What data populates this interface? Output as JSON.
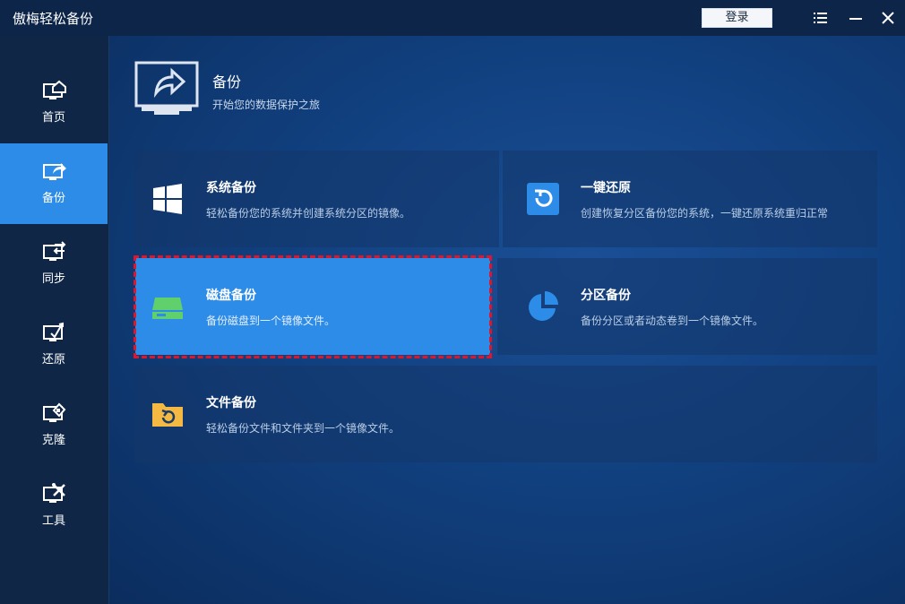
{
  "window": {
    "title": "傲梅轻松备份",
    "login_label": "登录",
    "controls": [
      "menu-icon",
      "minimize-icon",
      "close-icon"
    ]
  },
  "sidebar": {
    "items": [
      {
        "label": "首页",
        "icon": "home-monitor-icon",
        "active": false
      },
      {
        "label": "备份",
        "icon": "backup-monitor-icon",
        "active": true
      },
      {
        "label": "同步",
        "icon": "sync-monitor-icon",
        "active": false
      },
      {
        "label": "还原",
        "icon": "restore-monitor-icon",
        "active": false
      },
      {
        "label": "克隆",
        "icon": "clone-monitor-icon",
        "active": false
      },
      {
        "label": "工具",
        "icon": "tools-monitor-icon",
        "active": false
      }
    ]
  },
  "header": {
    "title": "备份",
    "subtitle": "开始您的数据保护之旅",
    "icon": "backup-monitor-large-icon"
  },
  "cards": [
    {
      "title": "系统备份",
      "desc": "轻松备份您的系统并创建系统分区的镜像。",
      "icon": "windows-icon"
    },
    {
      "title": "一键还原",
      "desc": "创建恢复分区备份您的系统，一键还原系统重归正常",
      "icon": "one-key-restore-icon"
    },
    {
      "title": "磁盘备份",
      "desc": "备份磁盘到一个镜像文件。",
      "icon": "disk-icon",
      "selected": true
    },
    {
      "title": "分区备份",
      "desc": "备份分区或者动态卷到一个镜像文件。",
      "icon": "partition-pie-icon"
    },
    {
      "title": "文件备份",
      "desc": "轻松备份文件和文件夹到一个镜像文件。",
      "icon": "file-folder-icon"
    }
  ],
  "colors": {
    "accent": "#2d8ce8",
    "selection_border": "#e0142a",
    "disk_icon": "#5fd06c",
    "folder_icon": "#f4b942"
  }
}
